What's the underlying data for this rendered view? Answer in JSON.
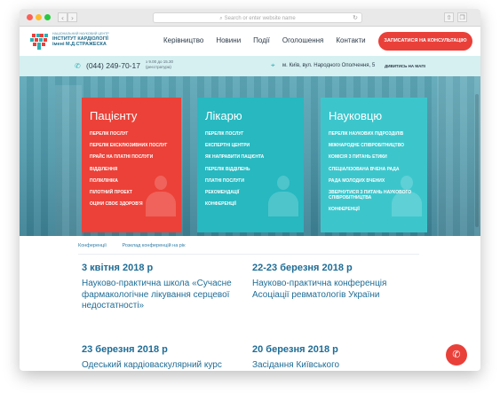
{
  "browser": {
    "address_placeholder": "Search or enter website name",
    "nav": [
      "‹",
      "›"
    ],
    "reload_icon": "reload-icon",
    "share_icon": "share-icon",
    "tabs_icon": "tabs-icon"
  },
  "header": {
    "logo": {
      "line1": "НАЦІОНАЛЬНИЙ НАУКОВИЙ ЦЕНТР",
      "line2": "ІНСТИТУТ КАРДІОЛОГІЇ",
      "line3": "імені М.Д.СТРАЖЕСКА"
    },
    "menu": [
      "Керівництво",
      "Новини",
      "Події",
      "Оголошення",
      "Контакти"
    ],
    "cta": "ЗАПИСАТИСЯ НА КОНСУЛЬТАЦІЮ"
  },
  "contact": {
    "phone": "(044) 249-70-17",
    "hours_line1": "з 9.00 до 15.30",
    "hours_line2": "(реєстратура)",
    "address": "м. Київ, вул. Народного Ополчення, 5",
    "map_link": "ДИВИТИСЬ НА МАПІ"
  },
  "cards": [
    {
      "title": "Пацієнту",
      "items": [
        "ПЕРЕЛІК ПОСЛУГ",
        "ПЕРЕЛІК ЕКСКЛЮЗИВНИХ ПОСЛУГ",
        "ПРАЙС НА ПЛАТНІ ПОСЛУГИ",
        "ВІДДІЛЕННЯ",
        "ПОЛІКЛІНІКА",
        "ПІЛОТНИЙ ПРОЕКТ",
        "ОЦІНИ СВОЄ ЗДОРОВ'Я"
      ]
    },
    {
      "title": "Лікарю",
      "items": [
        "ПЕРЕЛІК ПОСЛУГ",
        "ЕКСПЕРТНІ ЦЕНТРИ",
        "ЯК НАПРАВИТИ ПАЦІЄНТА",
        "ПЕРЕЛІК ВІДДІЛЕНЬ",
        "ПЛАТНІ ПОСЛУГИ",
        "РЕКОМЕНДАЦІЇ",
        "КОНФЕРЕНЦІЇ"
      ]
    },
    {
      "title": "Науковцю",
      "items": [
        "ПЕРЕЛІК НАУКОВИХ ПІДРОЗДІЛІВ",
        "МІЖНАРОДНЕ СПІВРОБІТНИЦТВО",
        "КОМІСІЯ З ПИТАНЬ ЕТИКИ",
        "СПЕЦІАЛІЗОВАНА ВЧЕНА РАДА",
        "РАДА МОЛОДИХ ВЧЕНИХ",
        "ЗВЕРНУТИСЯ З ПИТАНЬ НАУКОВОГО СПІВРОБІТНИЦТВА",
        "КОНФЕРЕНЦІЇ"
      ]
    }
  ],
  "subtabs": [
    "Конференції",
    "Розклад конференцій на рік"
  ],
  "events": [
    {
      "date": "3 квітня 2018 р",
      "desc": "Науково-практична школа «Сучасне фармакологічне лікування серцевої недостатності»"
    },
    {
      "date": "22-23 березня 2018 р",
      "desc": "Науково-практична конференція Асоціації ревматологів України"
    },
    {
      "date": "23 березня 2018 р",
      "desc": "Одеський кардіоваскулярний курс"
    },
    {
      "date": "20 березня 2018 р",
      "desc": "Засідання Київського"
    }
  ],
  "colors": {
    "accent_red": "#e9403a",
    "teal": "#27b8c0",
    "link_blue": "#1f6c95"
  }
}
